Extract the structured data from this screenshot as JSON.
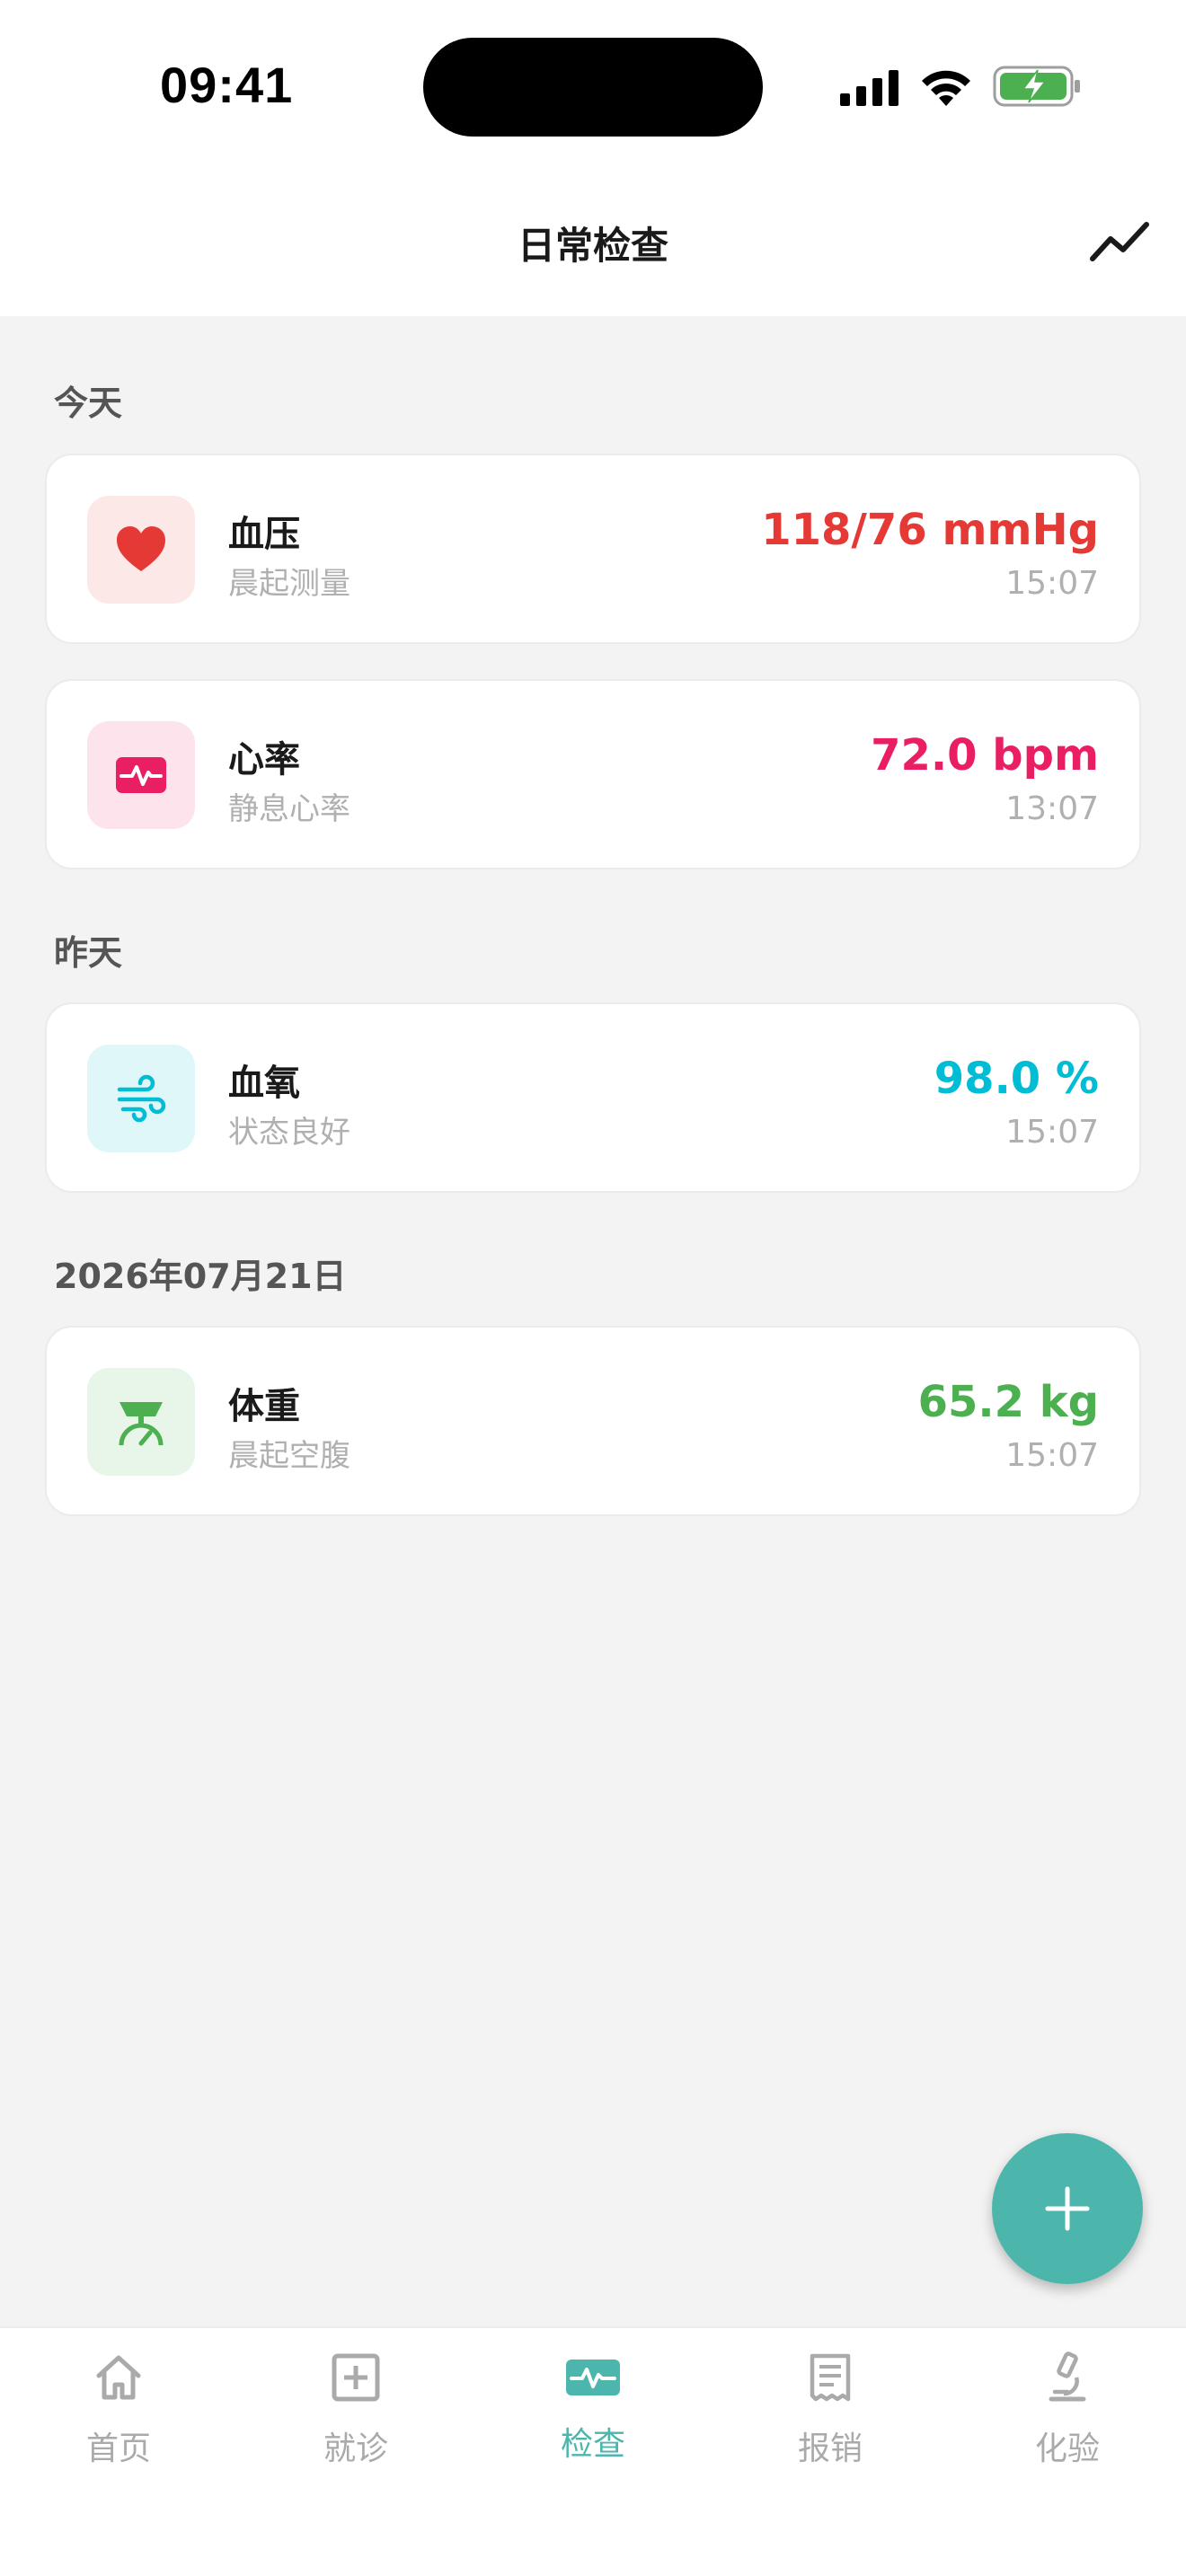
{
  "status": {
    "time": "09:41"
  },
  "header": {
    "title": "日常检查"
  },
  "sections": [
    {
      "label": "今天"
    },
    {
      "label": "昨天"
    },
    {
      "label": "2026年07月21日"
    }
  ],
  "records": [
    {
      "name": "血压",
      "note": "晨起测量",
      "value": "118/76 mmHg",
      "time": "15:07",
      "color": "#e53935",
      "icon": "heart-icon"
    },
    {
      "name": "心率",
      "note": "静息心率",
      "value": "72.0 bpm",
      "time": "13:07",
      "color": "#e91e63",
      "icon": "heartbeat-icon"
    },
    {
      "name": "血氧",
      "note": "状态良好",
      "value": "98.0 %",
      "time": "15:07",
      "color": "#00bcd4",
      "icon": "wind-icon"
    },
    {
      "name": "体重",
      "note": "晨起空腹",
      "value": "65.2 kg",
      "time": "15:07",
      "color": "#4caf50",
      "icon": "scale-icon"
    }
  ],
  "tabbar": {
    "tabs": [
      {
        "label": "首页",
        "icon": "home-icon"
      },
      {
        "label": "就诊",
        "icon": "medical-plus-icon"
      },
      {
        "label": "检查",
        "icon": "pulse-icon",
        "active": true
      },
      {
        "label": "报销",
        "icon": "receipt-icon"
      },
      {
        "label": "化验",
        "icon": "microscope-icon"
      }
    ]
  },
  "colors": {
    "accent": "#4db6ac",
    "background": "#f3f3f3"
  }
}
